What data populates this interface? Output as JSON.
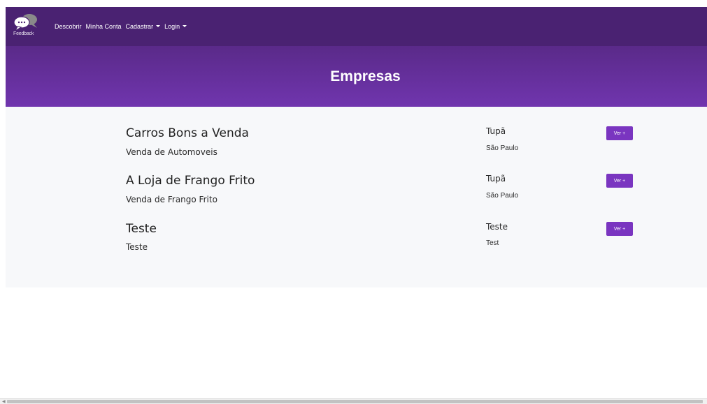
{
  "navbar": {
    "logo_text": "Feedback",
    "links": [
      {
        "label": "Descobrir",
        "dropdown": false
      },
      {
        "label": "Minha Conta",
        "dropdown": false
      },
      {
        "label": "Cadastrar",
        "dropdown": true
      },
      {
        "label": "Login",
        "dropdown": true
      }
    ]
  },
  "hero": {
    "title": "Empresas"
  },
  "companies": [
    {
      "name": "Carros Bons a Venda",
      "description": "Venda de Automoveis",
      "city": "Tupã",
      "state": "São Paulo",
      "button": "Ver +"
    },
    {
      "name": "A Loja de Frango Frito",
      "description": "Venda de Frango Frito",
      "city": "Tupã",
      "state": "São Paulo",
      "button": "Ver +"
    },
    {
      "name": "Teste",
      "description": "Teste",
      "city": "Teste",
      "state": "Test",
      "button": "Ver +"
    }
  ],
  "colors": {
    "navbar": "#4a2272",
    "hero_top": "#5a2a89",
    "hero_bottom": "#7035ae",
    "button": "#7a35c0",
    "content_bg": "#f7f8fa"
  },
  "icons": {
    "logo": "speech-bubbles-icon",
    "dropdown": "caret-down-icon",
    "scroll_left": "arrow-left-icon"
  }
}
